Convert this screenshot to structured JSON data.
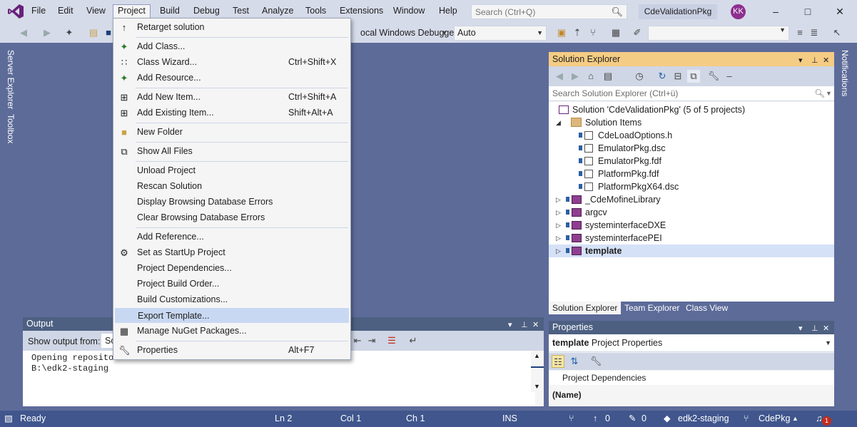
{
  "menubar": {
    "items": [
      "File",
      "Edit",
      "View",
      "Project",
      "Build",
      "Debug",
      "Test",
      "Analyze",
      "Tools",
      "Extensions",
      "Window",
      "Help"
    ],
    "search_placeholder": "Search (Ctrl+Q)",
    "solution_title": "CdeValidationPkg",
    "avatar_initials": "KK"
  },
  "toolbar": {
    "debugger_label": "ocal Windows Debugger",
    "config_value": "Auto"
  },
  "side_tabs": {
    "left": [
      "Server Explorer",
      "Toolbox"
    ],
    "right": [
      "Notifications"
    ]
  },
  "project_menu": {
    "items": [
      {
        "label": "Retarget solution",
        "shortcut": "",
        "icon": "arrow-up-icon"
      },
      {
        "label": "Add Class...",
        "shortcut": "",
        "icon": "add-class-icon"
      },
      {
        "label": "Class Wizard...",
        "shortcut": "Ctrl+Shift+X",
        "icon": "class-wizard-icon"
      },
      {
        "label": "Add Resource...",
        "shortcut": "",
        "icon": "add-resource-icon"
      },
      {
        "label": "Add New Item...",
        "shortcut": "Ctrl+Shift+A",
        "icon": "add-new-item-icon"
      },
      {
        "label": "Add Existing Item...",
        "shortcut": "Shift+Alt+A",
        "icon": "add-existing-item-icon"
      },
      {
        "label": "New Folder",
        "shortcut": "",
        "icon": "new-folder-icon"
      },
      {
        "label": "Show All Files",
        "shortcut": "",
        "icon": "show-all-files-icon"
      },
      {
        "label": "Unload Project",
        "shortcut": "",
        "icon": ""
      },
      {
        "label": "Rescan Solution",
        "shortcut": "",
        "icon": ""
      },
      {
        "label": "Display Browsing Database Errors",
        "shortcut": "",
        "icon": ""
      },
      {
        "label": "Clear Browsing Database Errors",
        "shortcut": "",
        "icon": ""
      },
      {
        "label": "Add Reference...",
        "shortcut": "",
        "icon": ""
      },
      {
        "label": "Set as StartUp Project",
        "shortcut": "",
        "icon": "gear-icon"
      },
      {
        "label": "Project Dependencies...",
        "shortcut": "",
        "icon": ""
      },
      {
        "label": "Project Build Order...",
        "shortcut": "",
        "icon": ""
      },
      {
        "label": "Build Customizations...",
        "shortcut": "",
        "icon": ""
      },
      {
        "label": "Export Template...",
        "shortcut": "",
        "icon": ""
      },
      {
        "label": "Manage NuGet Packages...",
        "shortcut": "",
        "icon": "nuget-icon"
      },
      {
        "label": "Properties",
        "shortcut": "Alt+F7",
        "icon": "wrench-icon"
      }
    ],
    "highlighted": "Export Template..."
  },
  "solution_explorer": {
    "title": "Solution Explorer",
    "search_placeholder": "Search Solution Explorer (Ctrl+ü)",
    "solution": "Solution 'CdeValidationPkg' (5 of 5 projects)",
    "folder": "Solution Items",
    "files": [
      "CdeLoadOptions.h",
      "EmulatorPkg.dsc",
      "EmulatorPkg.fdf",
      "PlatformPkg.fdf",
      "PlatformPkgX64.dsc"
    ],
    "projects": [
      "_CdeMofineLibrary",
      "argcv",
      "systeminterfaceDXE",
      "systeminterfacePEI",
      "template"
    ],
    "selected_project": "template",
    "tabs": [
      "Solution Explorer",
      "Team Explorer",
      "Class View"
    ]
  },
  "properties": {
    "title": "Properties",
    "object_name": "template",
    "object_type": "Project Properties",
    "row_label": "Project Dependencies",
    "desc_title": "(Name)"
  },
  "output": {
    "title": "Output",
    "show_from_label": "Show output from:",
    "show_from_value": "So",
    "lines": [
      "Opening reposito",
      "B:\\edk2-staging"
    ]
  },
  "status": {
    "ready": "Ready",
    "ln": "Ln 2",
    "col": "Col 1",
    "ch": "Ch 1",
    "ins": "INS",
    "up_count": "0",
    "pencil_count": "0",
    "branch": "edk2-staging",
    "repo": "CdePkg",
    "notification_count": "1"
  }
}
